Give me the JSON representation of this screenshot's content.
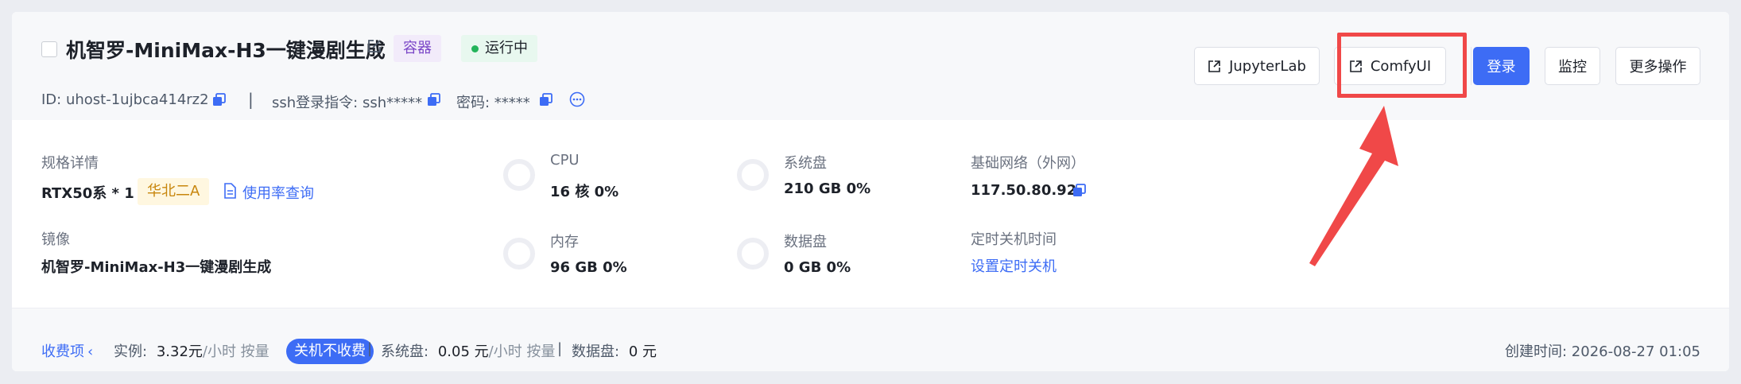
{
  "header": {
    "title": "机智罗-MiniMax-H3一键漫剧生成",
    "tag_container": "容器",
    "tag_status": "运行中",
    "id_text": "ID: uhost-1ujbca414rz2",
    "divider": "|",
    "ssh_text": "ssh登录指令: ssh*****",
    "password_text": "密码: *****",
    "buttons": {
      "jupyterlab": "JupyterLab",
      "comfyui": "ComfyUI",
      "login": "登录",
      "monitor": "监控",
      "more": "更多操作"
    }
  },
  "spec": {
    "label": "规格详情",
    "value": "RTX50系 * 1",
    "region": "华北二A",
    "usage_link": "使用率查询"
  },
  "image": {
    "label": "镜像",
    "value": "机智罗-MiniMax-H3一键漫剧生成"
  },
  "cpu": {
    "label": "CPU",
    "value": "16 核 0%",
    "usage": 0
  },
  "memory": {
    "label": "内存",
    "value": "96 GB 0%",
    "usage": 0
  },
  "system_disk": {
    "label": "系统盘",
    "value": "210 GB 0%",
    "usage": 0
  },
  "data_disk": {
    "label": "数据盘",
    "value": "0 GB 0%",
    "usage": 0
  },
  "network": {
    "label": "基础网络（外网）",
    "value": "117.50.80.92"
  },
  "shutdown": {
    "label": "定时关机时间",
    "link": "设置定时关机"
  },
  "footer": {
    "billing_link": "收费项",
    "instance_label": "实例:",
    "instance_price": "3.32元",
    "instance_unit": "/小时 按量",
    "no_charge_pill": "关机不收费",
    "sep": "|",
    "sys_disk_label": "系统盘:",
    "sys_disk_price": "0.05 元",
    "sys_disk_unit": "/小时 按量",
    "data_disk_label": "数据盘:",
    "data_disk_price": "0 元",
    "created": "创建时间: 2026-08-27 01:05"
  },
  "colors": {
    "primary": "#3d6cf5",
    "highlight": "#f04848",
    "status_green": "#23b45a"
  }
}
